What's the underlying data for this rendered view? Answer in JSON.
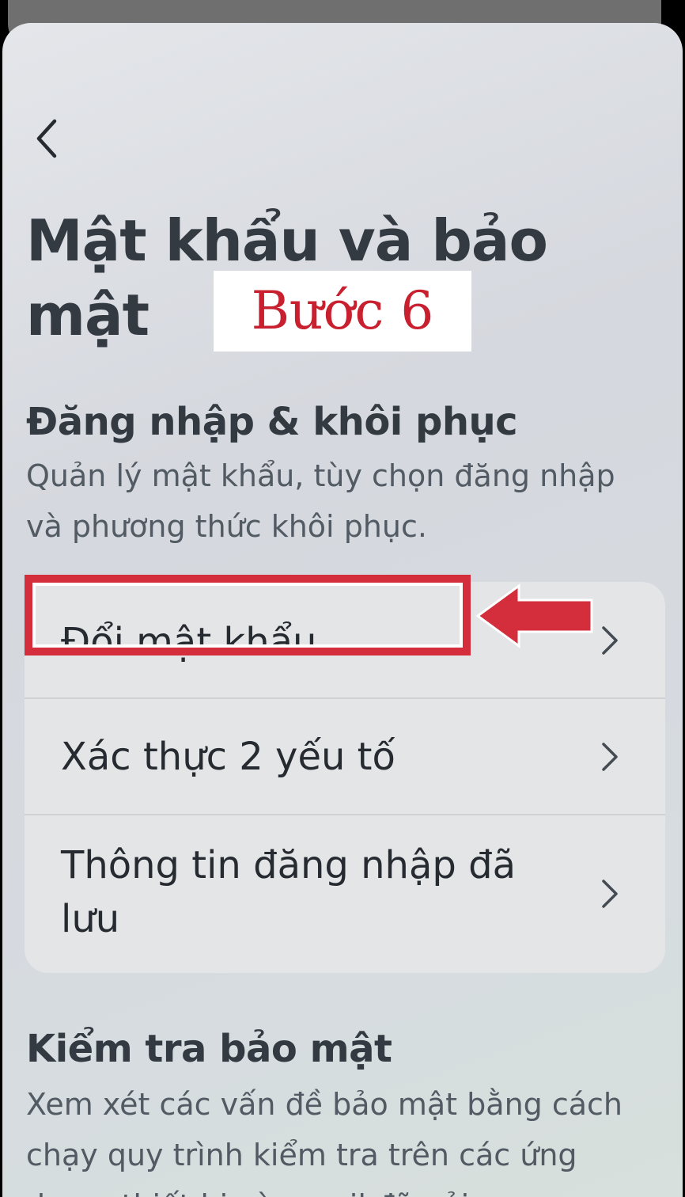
{
  "header": {
    "back_icon": "chevron-left-icon",
    "title": "Mật khẩu và bảo mật"
  },
  "annotation": {
    "step_label": "Bước 6",
    "highlight_color": "#d42e3d"
  },
  "login_section": {
    "heading": "Đăng nhập & khôi phục",
    "description": "Quản lý mật khẩu, tùy chọn đăng nhập và phương thức khôi phục.",
    "items": [
      {
        "label": "Đổi mật khẩu",
        "icon": "chevron-right-icon"
      },
      {
        "label": "Xác thực 2 yếu tố",
        "icon": "chevron-right-icon"
      },
      {
        "label": "Thông tin đăng nhập đã lưu",
        "icon": "chevron-right-icon"
      }
    ]
  },
  "security_check_section": {
    "heading": "Kiểm tra bảo mật",
    "description": "Xem xét các vấn đề bảo mật bằng cách chạy quy trình kiểm tra trên các ứng dụng, thiết bị và email đã gửi."
  }
}
